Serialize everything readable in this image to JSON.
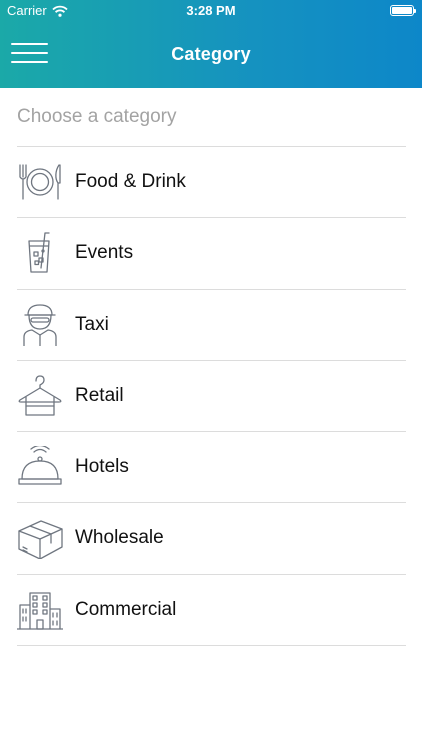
{
  "status_bar": {
    "carrier": "Carrier",
    "time": "3:28 PM"
  },
  "nav": {
    "title": "Category"
  },
  "prompt": "Choose a category",
  "categories": [
    {
      "label": "Food & Drink",
      "icon": "plate-fork-knife-icon"
    },
    {
      "label": "Events",
      "icon": "drink-glass-icon"
    },
    {
      "label": "Taxi",
      "icon": "driver-icon"
    },
    {
      "label": "Retail",
      "icon": "hanger-icon"
    },
    {
      "label": "Hotels",
      "icon": "service-bell-icon"
    },
    {
      "label": "Wholesale",
      "icon": "box-icon"
    },
    {
      "label": "Commercial",
      "icon": "building-icon"
    }
  ],
  "colors": {
    "header_start": "#1ba9a8",
    "header_end": "#0d87c9",
    "divider": "#dcdcdc",
    "prompt_text": "#a3a3a3"
  }
}
